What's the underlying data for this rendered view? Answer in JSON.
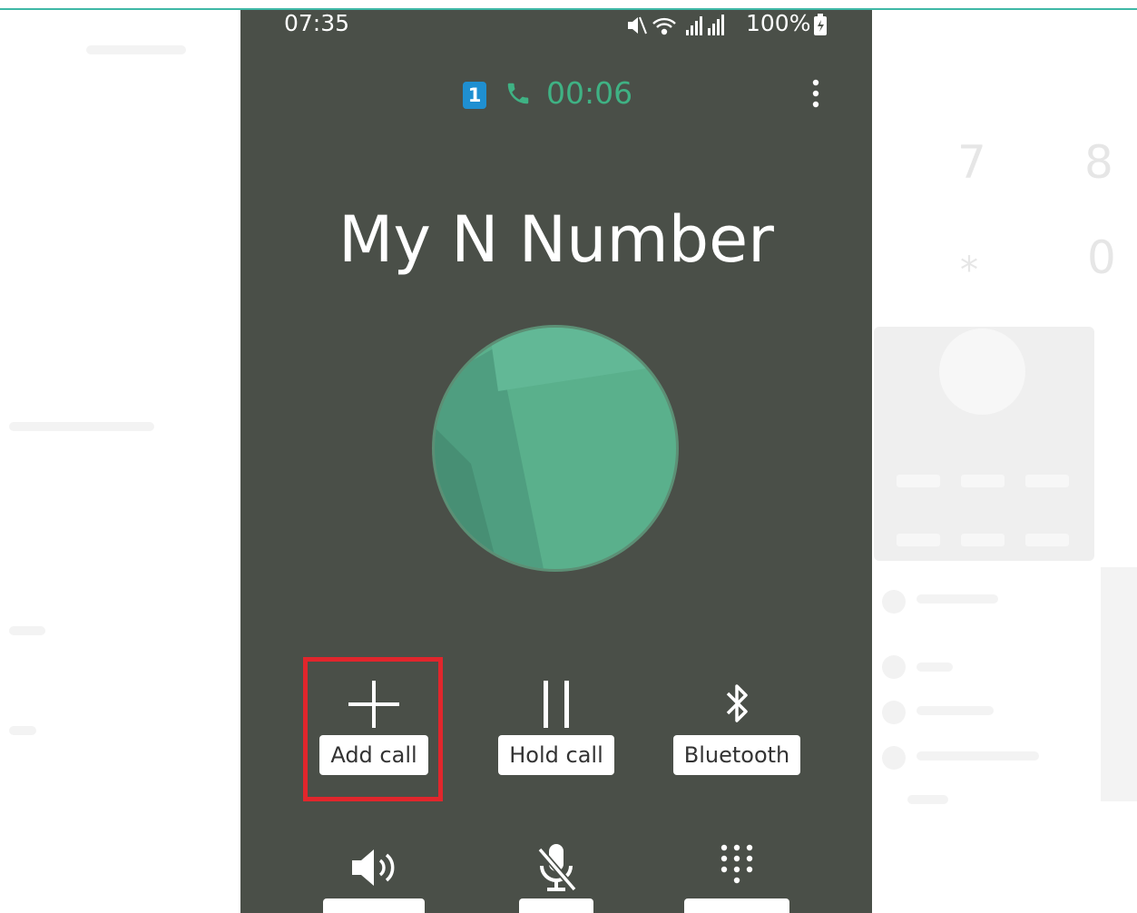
{
  "status_bar": {
    "time": "07:35",
    "battery": "100%",
    "icons": [
      "mute-icon",
      "wifi-icon",
      "signal-icon",
      "signal-icon",
      "battery-icon"
    ]
  },
  "call_header": {
    "sim_slot": "1",
    "timer": "00:06",
    "accent_color": "#3fb284",
    "sim_color": "#1f8fd1"
  },
  "contact": {
    "name": "My N Number",
    "avatar_color": "#5ab08c"
  },
  "actions": [
    {
      "label": "Add call",
      "icon": "plus-icon",
      "highlighted": true
    },
    {
      "label": "Hold call",
      "icon": "pause-icon"
    },
    {
      "label": "Bluetooth",
      "icon": "bluetooth-icon"
    },
    {
      "label": "",
      "icon": "speaker-icon"
    },
    {
      "label": "",
      "icon": "mute-mic-icon"
    },
    {
      "label": "",
      "icon": "keypad-icon"
    }
  ],
  "background": {
    "digits": [
      "7",
      "8",
      "*",
      "0"
    ],
    "highlight_color": "#e1262c"
  }
}
